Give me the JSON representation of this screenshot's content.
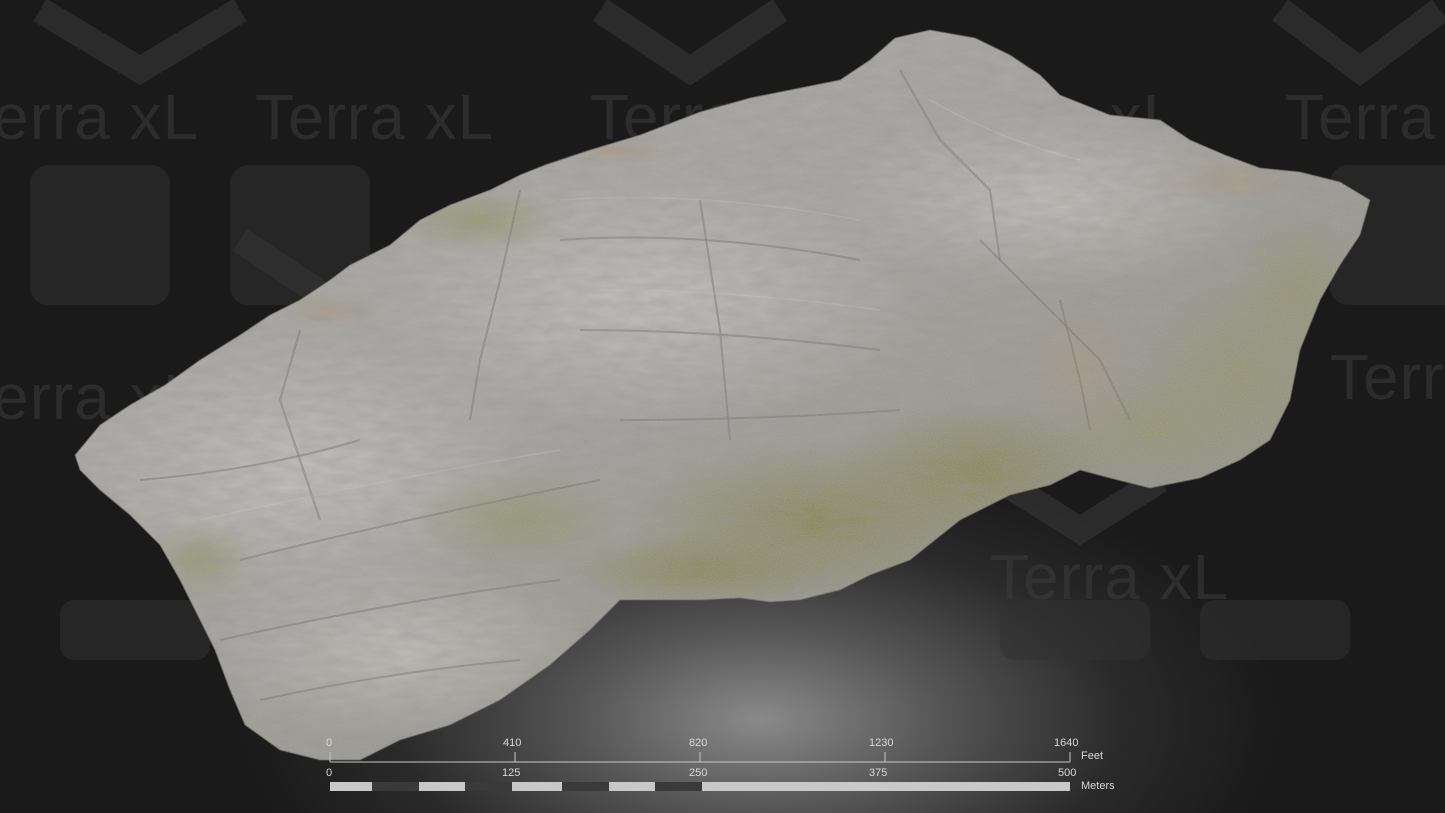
{
  "watermark": {
    "text": "Terra xL",
    "color": "#3c3c3c"
  },
  "terrain": {
    "description_colors": {
      "rock": "#9a9a98",
      "rock_light": "#c4c2bd",
      "rock_dark": "#5e5d58",
      "vegetation": "#7b7a3e",
      "soil": "#a58e74"
    }
  },
  "scale": {
    "feet": {
      "ticks": [
        "0",
        "410",
        "820",
        "1230",
        "1640"
      ],
      "unit": "Feet"
    },
    "meters": {
      "ticks": [
        "0",
        "125",
        "250",
        "375",
        "500"
      ],
      "unit": "Meters"
    },
    "colors": {
      "light": "#c8c8c8",
      "dark": "#3a3a3a",
      "line": "#c8c8c8"
    }
  }
}
